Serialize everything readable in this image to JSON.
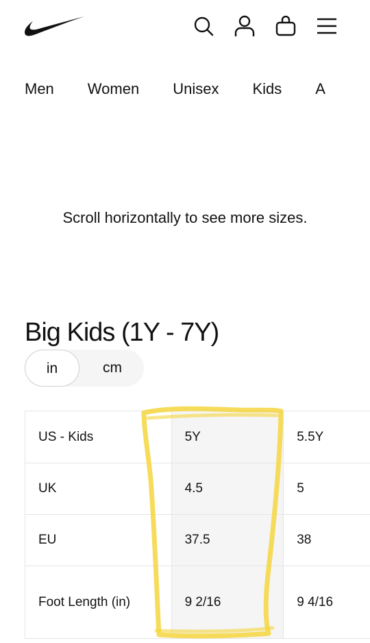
{
  "header": {
    "logo": "nike-swoosh-logo",
    "icons": [
      "search-icon",
      "user-icon",
      "bag-icon",
      "menu-icon"
    ]
  },
  "categories": [
    "Men",
    "Women",
    "Unisex",
    "Kids",
    "A"
  ],
  "hint": "Scroll horizontally to see more sizes.",
  "section": {
    "title": "Big Kids (1Y - 7Y)",
    "units": {
      "in": "in",
      "cm": "cm",
      "selected": "in"
    }
  },
  "table": {
    "rows": [
      {
        "label": "US - Kids",
        "values": [
          "5Y",
          "5.5Y"
        ]
      },
      {
        "label": "UK",
        "values": [
          "4.5",
          "5"
        ]
      },
      {
        "label": "EU",
        "values": [
          "37.5",
          "38"
        ]
      },
      {
        "label": "Foot Length (in)",
        "values": [
          "9 2/16",
          "9 4/16"
        ]
      }
    ]
  },
  "colors": {
    "text": "#111111",
    "highlight": "#f5d63d",
    "highlighted_column_bg": "#f5f5f5",
    "border": "#e5e5e5"
  }
}
